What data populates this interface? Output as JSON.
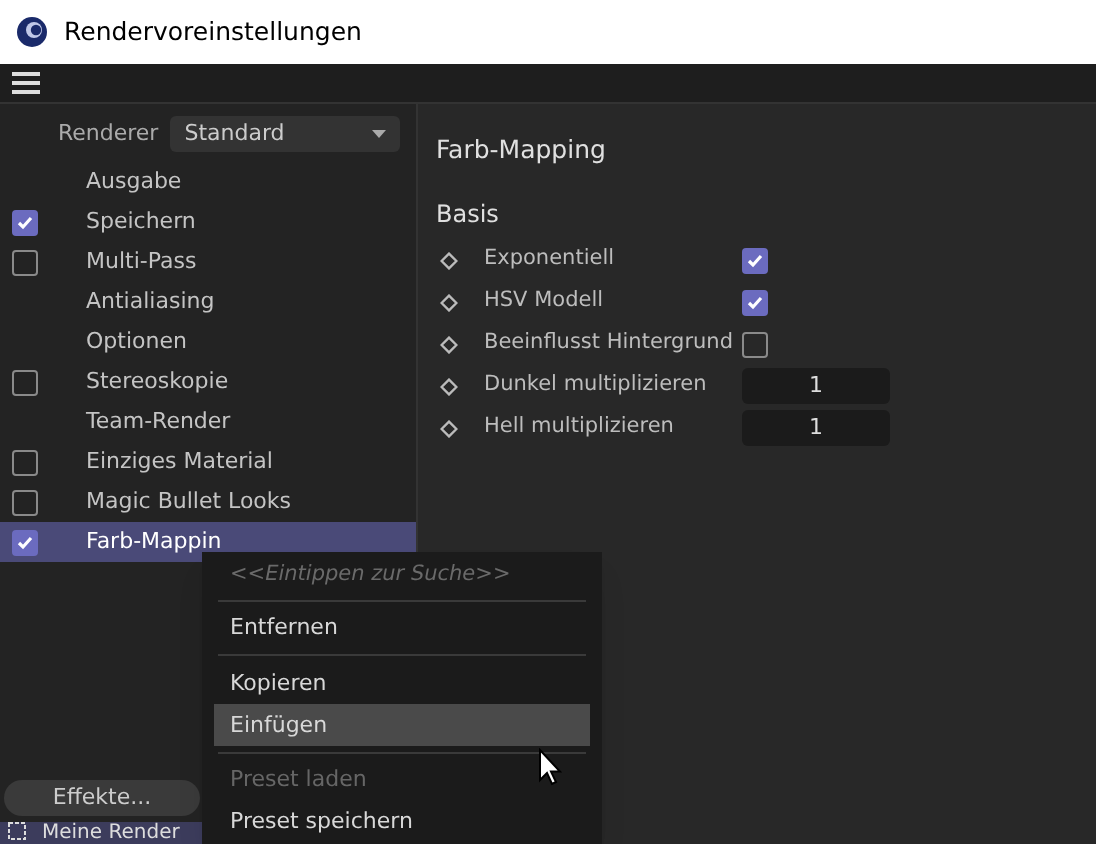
{
  "window": {
    "title": "Rendervoreinstellungen"
  },
  "renderer": {
    "label": "Renderer",
    "value": "Standard"
  },
  "sidebar": {
    "items": [
      {
        "label": "Ausgabe",
        "kind": "plain",
        "selected": false
      },
      {
        "label": "Speichern",
        "kind": "checkbox",
        "checked": true,
        "selected": false
      },
      {
        "label": "Multi-Pass",
        "kind": "checkbox",
        "checked": false,
        "selected": false
      },
      {
        "label": "Antialiasing",
        "kind": "plain",
        "selected": false
      },
      {
        "label": "Optionen",
        "kind": "plain",
        "selected": false
      },
      {
        "label": "Stereoskopie",
        "kind": "checkbox",
        "checked": false,
        "selected": false
      },
      {
        "label": "Team-Render",
        "kind": "plain",
        "selected": false
      },
      {
        "label": "Einziges Material",
        "kind": "checkbox",
        "checked": false,
        "selected": false
      },
      {
        "label": "Magic Bullet Looks",
        "kind": "checkbox",
        "checked": false,
        "selected": false
      },
      {
        "label": "Farb-Mappin",
        "kind": "checkbox",
        "checked": true,
        "selected": true
      }
    ]
  },
  "effects_button": "Effekte...",
  "presets": {
    "label": "Meine Render"
  },
  "panel": {
    "title": "Farb-Mapping",
    "section": "Basis",
    "params": [
      {
        "label": "Exponentiell",
        "kind": "checkbox",
        "checked": true
      },
      {
        "label": "HSV Modell",
        "kind": "checkbox",
        "checked": true
      },
      {
        "label": "Beeinflusst Hintergrund",
        "kind": "checkbox",
        "checked": false
      },
      {
        "label": "Dunkel multiplizieren",
        "kind": "number",
        "value": "1"
      },
      {
        "label": "Hell multiplizieren",
        "kind": "number",
        "value": "1"
      }
    ]
  },
  "context_menu": {
    "items": [
      {
        "kind": "search",
        "placeholder": "<<Eintippen zur Suche>>"
      },
      {
        "kind": "separator"
      },
      {
        "kind": "item",
        "label": "Entfernen",
        "selected": false,
        "disabled": false
      },
      {
        "kind": "separator"
      },
      {
        "kind": "item",
        "label": "Kopieren",
        "selected": false,
        "disabled": false
      },
      {
        "kind": "item",
        "label": "Einfügen",
        "selected": true,
        "disabled": false
      },
      {
        "kind": "separator"
      },
      {
        "kind": "item",
        "label": "Preset laden",
        "selected": false,
        "disabled": true
      },
      {
        "kind": "item",
        "label": "Preset speichern",
        "selected": false,
        "disabled": false
      }
    ]
  }
}
